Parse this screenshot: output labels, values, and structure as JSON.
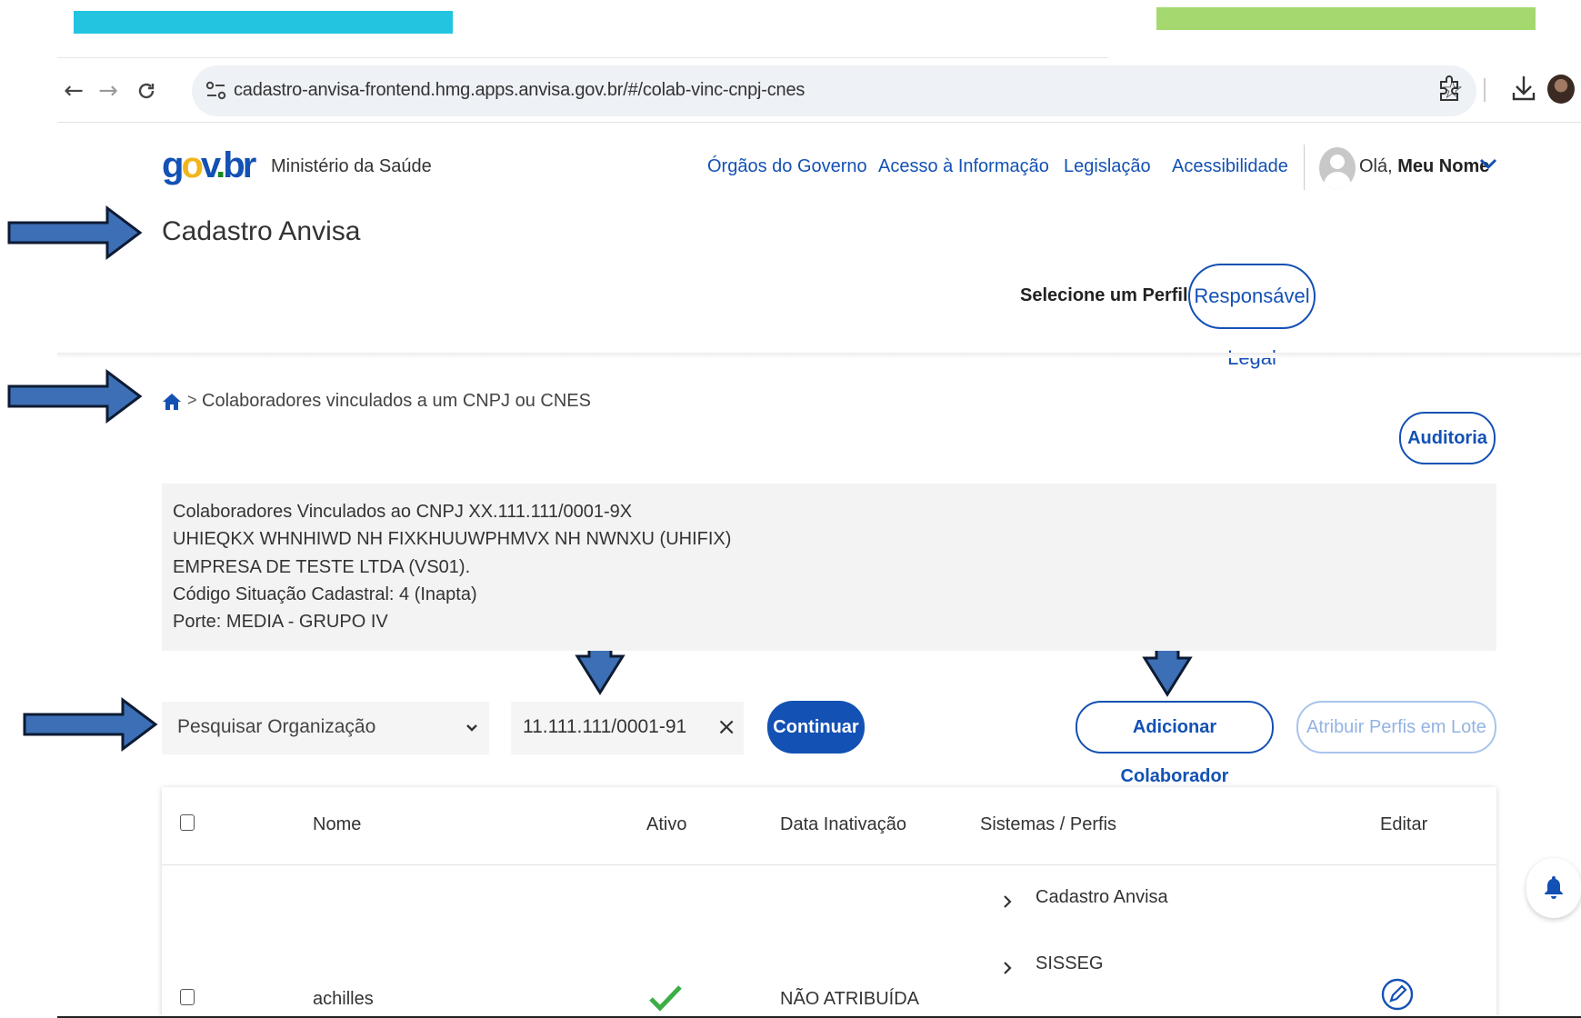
{
  "browser": {
    "url": "cadastro-anvisa-frontend.hmg.apps.anvisa.gov.br/#/colab-vinc-cnpj-cnes",
    "icons": [
      "back-icon",
      "forward-icon",
      "reload-icon",
      "site-info-icon",
      "star-icon",
      "extensions-icon",
      "download-icon",
      "profile-avatar"
    ]
  },
  "header": {
    "logo": {
      "g": "g",
      "o": "o",
      "v": "v",
      "dot": ".",
      "br": "br"
    },
    "ministry": "Ministério da Saúde",
    "links": [
      "Órgãos do Governo",
      "Acesso à Informação",
      "Legislação",
      "Acessibilidade"
    ],
    "greeting_prefix": "Olá, ",
    "user_name": "Meu Nome",
    "site_title": "Cadastro Anvisa",
    "profile_label": "Selecione um Perfil:",
    "profile_value": "Responsável Legal"
  },
  "breadcrumb": {
    "separator": ">",
    "current": "Colaboradores vinculados a um CNPJ ou CNES"
  },
  "actions": {
    "auditoria": "Auditoria",
    "continuar": "Continuar",
    "add_collaborator": "Adicionar Colaborador",
    "batch_profiles": "Atribuir Perfis em Lote"
  },
  "info": {
    "lines": [
      "Colaboradores Vinculados ao CNPJ XX.111.111/0001-9X",
      "UHIEQKX WHNHIWD NH FIXKHUUWPHMVX NH NWNXU (UHIFIX)",
      "EMPRESA DE TESTE LTDA (VS01).",
      "Código Situação Cadastral: 4 (Inapta)",
      "Porte: MEDIA - GRUPO IV"
    ]
  },
  "search": {
    "organization_select": "Pesquisar Organização",
    "cnpj_value": "11.111.111/0001-91",
    "clear": "×"
  },
  "table": {
    "headers": [
      "Nome",
      "Ativo",
      "Data Inativação",
      "Sistemas / Perfis",
      "Editar"
    ],
    "rows": [
      {
        "name": "achilles",
        "active": true,
        "inactivation_date": "NÃO ATRIBUÍDA",
        "systems": [
          "Cadastro Anvisa",
          "SISSEG"
        ]
      }
    ]
  },
  "colors": {
    "primary": "#1351b4",
    "annotation_arrow": "#3d6fb6",
    "check": "#168821",
    "top_bar_cyan": "#22c4e0",
    "top_bar_green": "#a5d96f"
  }
}
